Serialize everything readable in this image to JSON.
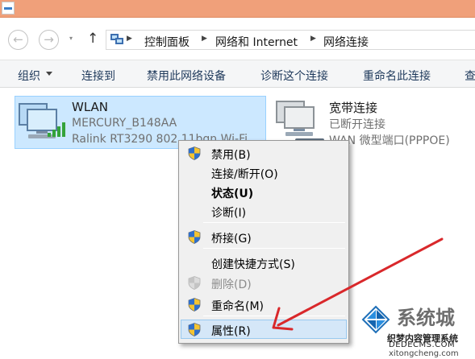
{
  "nav": {
    "back_glyph": "←",
    "forward_glyph": "→",
    "dropdown_glyph": "▾",
    "up_glyph": "↑",
    "breadcrumb_sep": "▶",
    "breadcrumbs": [
      "控制面板",
      "网络和 Internet",
      "网络连接"
    ]
  },
  "toolbar": {
    "items": [
      "组织",
      "连接到",
      "禁用此网络设备",
      "诊断这个连接",
      "重命名此连接",
      "查"
    ]
  },
  "connections": [
    {
      "name": "WLAN",
      "line1": "MERCURY_B148AA",
      "line2": "Ralink RT3290 802.11bgn Wi-Fi"
    },
    {
      "name": "宽带连接",
      "line1": "已断开连接",
      "line2": "WAN 微型端口(PPPOE)"
    }
  ],
  "context_menu": {
    "items": [
      {
        "label": "禁用(B)",
        "icon": "uac-shield-icon"
      },
      {
        "label": "连接/断开(O)",
        "icon": ""
      },
      {
        "label": "状态(U)",
        "icon": "",
        "bold": true
      },
      {
        "label": "诊断(I)",
        "icon": ""
      },
      {
        "label": "桥接(G)",
        "icon": "uac-shield-icon"
      },
      {
        "label": "创建快捷方式(S)",
        "icon": ""
      },
      {
        "label": "删除(D)",
        "icon": "uac-shield-icon",
        "disabled": true
      },
      {
        "label": "重命名(M)",
        "icon": "uac-shield-icon"
      },
      {
        "label": "属性(R)",
        "icon": "uac-shield-icon",
        "highlighted": true
      }
    ]
  },
  "annotation": {
    "arrow_color": "#d9282b",
    "points_to": "属性(R)"
  },
  "watermark": {
    "title": "系统城",
    "line1": "织梦内容管理系统",
    "line2": "DEDECMS.COM",
    "line3": "xitongcheng.com"
  },
  "colors": {
    "title_strip": "#f0a07a",
    "selection_fill": "#cce8ff",
    "menu_highlight": "#d5e7f8",
    "signal_green": "#34a33a"
  }
}
